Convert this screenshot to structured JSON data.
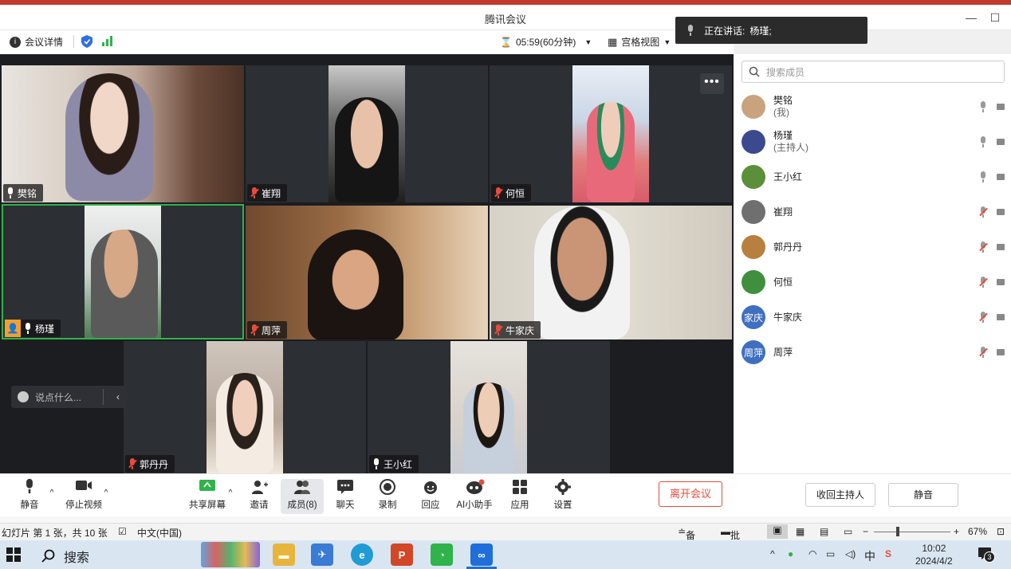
{
  "window": {
    "title": "腾讯会议"
  },
  "top_toolbar": {
    "meeting_details": "会议详情",
    "timer": "05:59(60分钟)",
    "view_mode": "宫格视图"
  },
  "speaking_banner": {
    "label": "正在讲话:",
    "speaker": "杨瑾;"
  },
  "tiles": [
    {
      "name": "樊铭",
      "muted": false
    },
    {
      "name": "崔翔",
      "muted": true
    },
    {
      "name": "何恒",
      "muted": true
    },
    {
      "name": "杨瑾",
      "muted": false,
      "host": true
    },
    {
      "name": "周萍",
      "muted": true
    },
    {
      "name": "牛家庆",
      "muted": true
    },
    {
      "name": "郭丹丹",
      "muted": true
    },
    {
      "name": "王小红",
      "muted": false
    }
  ],
  "chat_input": {
    "placeholder": "说点什么..."
  },
  "members_panel": {
    "search_placeholder": "搜索成员",
    "members": [
      {
        "name": "樊铭",
        "sub": "(我)",
        "avatar_color": "#c9a27e",
        "avatar_text": "",
        "muted": false
      },
      {
        "name": "杨瑾",
        "sub": "(主持人)",
        "avatar_color": "#3b4a8f",
        "avatar_text": "",
        "muted": false
      },
      {
        "name": "王小红",
        "sub": "",
        "avatar_color": "#5b8f3a",
        "avatar_text": "",
        "muted": false
      },
      {
        "name": "崔翔",
        "sub": "",
        "avatar_color": "#6f6f6f",
        "avatar_text": "",
        "muted": true
      },
      {
        "name": "郭丹丹",
        "sub": "",
        "avatar_color": "#b8803f",
        "avatar_text": "",
        "muted": true
      },
      {
        "name": "何恒",
        "sub": "",
        "avatar_color": "#3f8f3f",
        "avatar_text": "",
        "muted": true
      },
      {
        "name": "牛家庆",
        "sub": "",
        "avatar_color": "#3f6fc0",
        "avatar_text": "家庆",
        "muted": true
      },
      {
        "name": "周萍",
        "sub": "",
        "avatar_color": "#3f6fc0",
        "avatar_text": "周萍",
        "muted": true
      }
    ],
    "reclaim_host": "收回主持人",
    "mute_all": "静音"
  },
  "bottom_toolbar": {
    "mute": "静音",
    "stop_video": "停止视频",
    "share_screen": "共享屏幕",
    "invite": "邀请",
    "members": "成员(8)",
    "chat": "聊天",
    "record": "录制",
    "replay": "回应",
    "ai_assistant": "AI小助手",
    "apps": "应用",
    "settings": "设置",
    "leave": "离开会议"
  },
  "ppt_status": {
    "slide_info": "幻灯片 第 1 张，共 10 张",
    "language": "中文(中国)",
    "notes": "备注",
    "comments": "批注",
    "zoom": "67%"
  },
  "taskbar": {
    "search": "搜索",
    "ime": "中",
    "time": "10:02",
    "date": "2024/4/2",
    "notifications": "3"
  }
}
